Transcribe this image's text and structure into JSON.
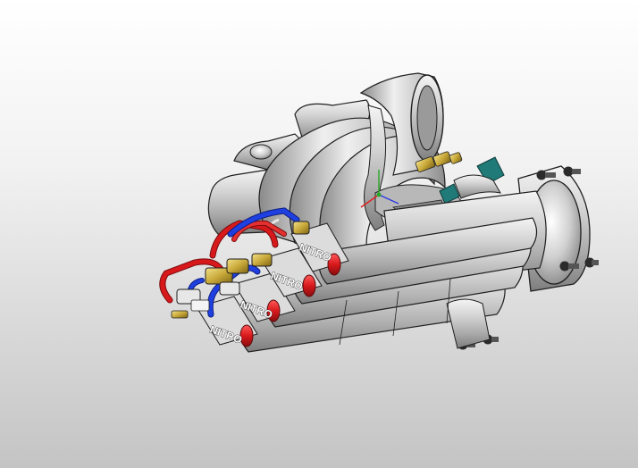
{
  "scene": {
    "subject": "intake-manifold-nitrous-kit",
    "runner_count": 4,
    "nozzle_label": "NITRO",
    "colors": {
      "background_top": "#ffffff",
      "background_bottom": "#c4c4c4",
      "metal": "#c8c8c8",
      "metal_dark": "#8e8e8e",
      "outline": "#1f1f1f",
      "red_line": "#d8191c",
      "blue_line": "#1f3fe0",
      "brass": "#c9a93a",
      "teal": "#1f7a78",
      "bolt": "#2b2b2b"
    }
  },
  "icons": {
    "triad": "axis-triad-icon"
  }
}
